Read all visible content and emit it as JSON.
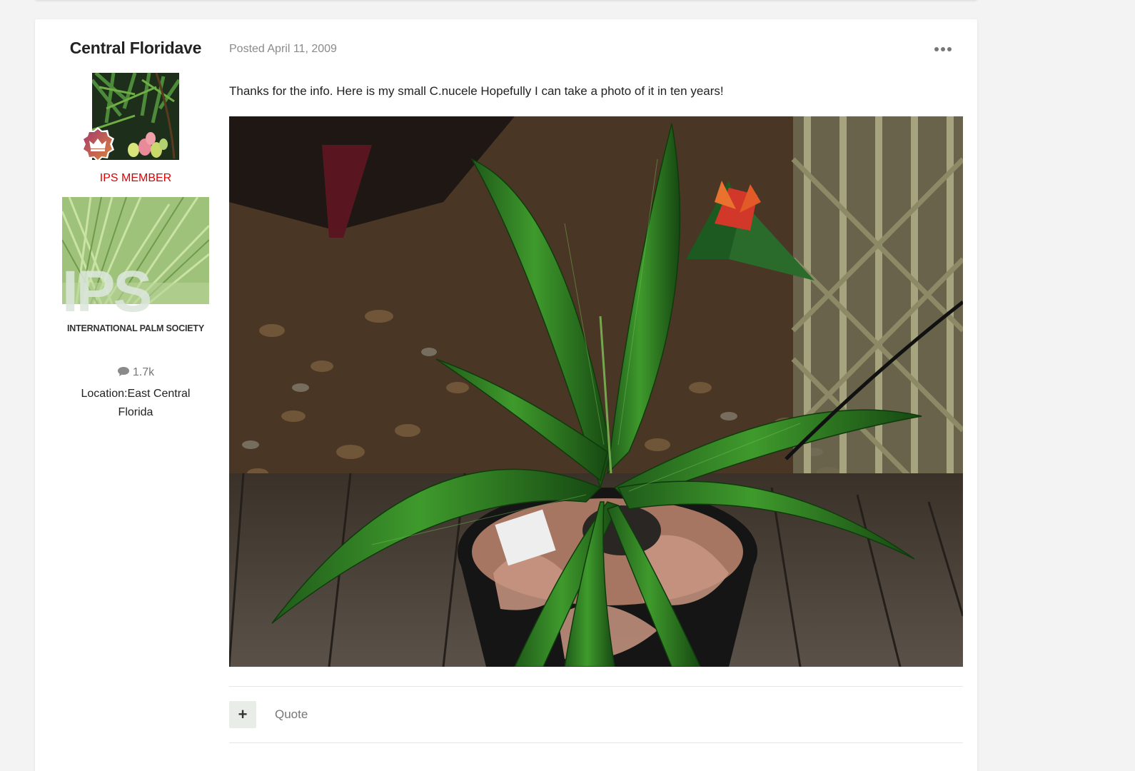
{
  "author": {
    "name": "Central Floridave",
    "group": "IPS MEMBER",
    "banner_title": "IPS",
    "banner_subtitle": "INTERNATIONAL PALM SOCIETY",
    "post_count": "1.7k",
    "location": "Location:East Central Florida"
  },
  "post": {
    "posted": "Posted April 11, 2009",
    "text": "Thanks for the info. Here is my small C.nucele Hopefully I can take a photo of it in ten years!"
  },
  "actions": {
    "react_label": "+",
    "quote_label": "Quote"
  },
  "colors": {
    "group_label": "#e00000",
    "page_bg": "#f3f3f3",
    "card_bg": "#ffffff"
  },
  "icons": {
    "more": "ellipsis-icon",
    "comment": "comment-icon",
    "rank": "crown-badge-icon"
  }
}
